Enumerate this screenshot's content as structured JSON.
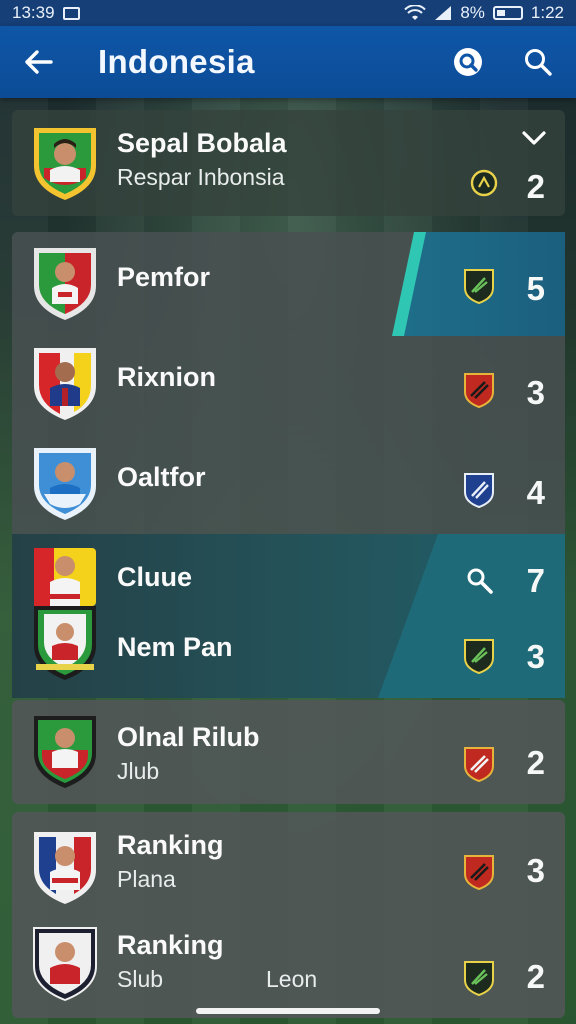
{
  "status_bar": {
    "time_left": "13:39",
    "battery_text": "8%",
    "time_right": "1:22"
  },
  "app_bar": {
    "title": "Indonesia"
  },
  "header_card": {
    "name": "Sepal Bobala",
    "sub": "Respar Inbonsia",
    "count": "2"
  },
  "list": [
    {
      "name": "Pemfor",
      "sub": "",
      "count": "5",
      "highlight": "teal-right"
    },
    {
      "name": "Rixnion",
      "sub": "",
      "count": "3"
    },
    {
      "name": "Oaltfor",
      "sub": "",
      "count": "4"
    },
    {
      "name": "Cluue",
      "sub": "",
      "count": "7",
      "highlight": "teal-right",
      "icon": "search-icon"
    },
    {
      "name": "Nem Pan",
      "sub": "",
      "count": "3",
      "highlight": "teal-right"
    },
    {
      "name": "Olnal Rilub",
      "sub": "Jlub",
      "count": "2"
    },
    {
      "name": "Ranking",
      "sub": "Plana",
      "count": "3"
    },
    {
      "name": "Ranking",
      "sub": "Slub",
      "count": "2",
      "extra": "Leon"
    }
  ],
  "colors": {
    "app_bar": "#0f56a8",
    "status_bar": "#163f78",
    "card": "#464e50",
    "teal": "#2aa6a0"
  }
}
